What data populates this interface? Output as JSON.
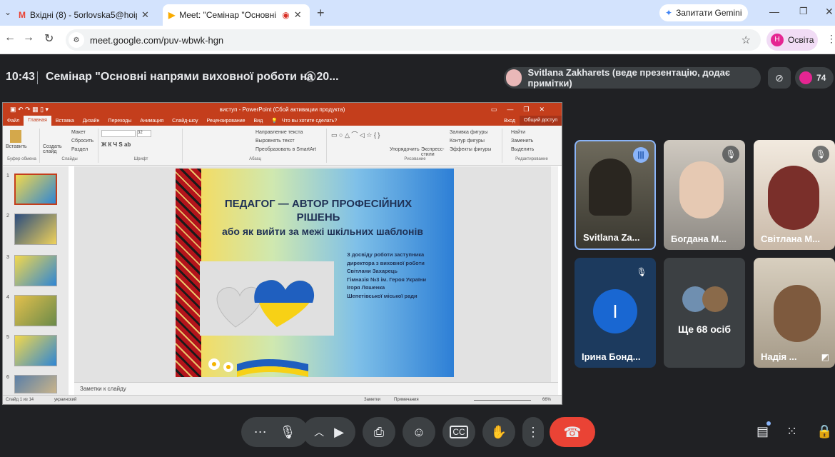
{
  "browser": {
    "tabs": [
      {
        "title": "Вхідні (8) - 5orlovska5@hoippo..."
      },
      {
        "title": "Meet: \"Семінар \"Основні н..."
      }
    ],
    "gemini_label": "Запитати Gemini",
    "url": "meet.google.com/puv-wbwk-hgn",
    "profile_label": "Освіта",
    "profile_initial": "Н"
  },
  "meet": {
    "time": "10:43",
    "title": "Семінар \"Основні напрями виховної роботи на 20...",
    "presenter": "Svitlana Zakharets (веде презентацію, додає примітки)",
    "participant_count": "74",
    "participants": [
      {
        "name": "Svitlana Za..."
      },
      {
        "name": "Богдана М..."
      },
      {
        "name": "Світлана М..."
      },
      {
        "name": "Ірина Бонд...",
        "initial": "І"
      },
      {
        "name": "Ще 68 осіб"
      },
      {
        "name": "Надія ..."
      }
    ]
  },
  "powerpoint": {
    "window_title": "виступ - PowerPoint (Сбой активации продукта)",
    "ribbon_tabs": [
      "Файл",
      "Главная",
      "Вставка",
      "Дизайн",
      "Переходы",
      "Анимация",
      "Слайд-шоу",
      "Рецензирование",
      "Вид"
    ],
    "tell_me": "Что вы хотите сделать?",
    "login": "Вход",
    "share": "Общий доступ",
    "groups": [
      "Буфер обмена",
      "Слайды",
      "Шрифт",
      "Абзац",
      "Рисование",
      "Редактирование"
    ],
    "buttons": {
      "paste": "Вставить",
      "new_slide": "Создать слайд",
      "layout": "Макет",
      "reset": "Сбросить",
      "section": "Раздел",
      "text_dir": "Направление текста",
      "align_text": "Выровнять текст",
      "smartart": "Преобразовать в SmartArt",
      "arrange": "Упорядочить",
      "quick_styles": "Экспресс-стили",
      "fill": "Заливка фигуры",
      "outline": "Контур фигуры",
      "effects": "Эффекты фигуры",
      "find": "Найти",
      "replace": "Заменить",
      "select": "Выделить"
    },
    "font_size": "32",
    "slide_numbers": [
      "1",
      "2",
      "3",
      "4",
      "5",
      "6"
    ],
    "notes_placeholder": "Заметки к слайду",
    "status": {
      "slide": "Слайд 1 из 14",
      "lang": "украинский",
      "notes": "Заметки",
      "comments": "Примечания",
      "zoom": "66%"
    },
    "slide": {
      "title": "ПЕДАГОГ — АВТОР ПРОФЕСІЙНИХ РІШЕНЬ",
      "subtitle": "або як вийти за межі шкільних шаблонів",
      "body_lines": [
        "З досвіду роботи заступника",
        "директора з виховної роботи",
        "Світлани Захарець",
        "Гімназія №3 ім. Героя України",
        "Ігоря Ляшенка",
        "Шепетівської міської ради"
      ]
    }
  },
  "colors": {
    "meet_bg": "#202124",
    "end_call": "#ea4335",
    "ppt_accent": "#c43e1c"
  }
}
